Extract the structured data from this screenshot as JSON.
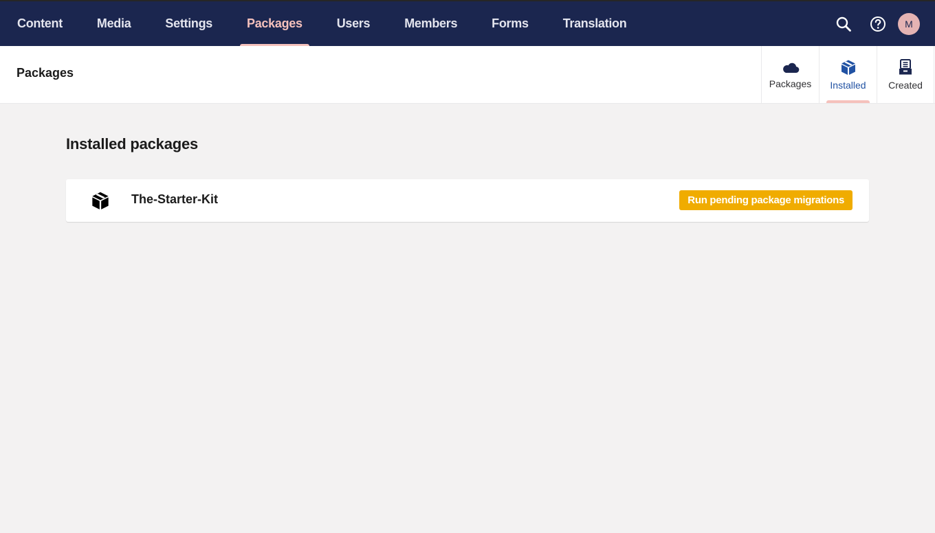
{
  "topnav": {
    "items": [
      {
        "label": "Content",
        "active": false
      },
      {
        "label": "Media",
        "active": false
      },
      {
        "label": "Settings",
        "active": false
      },
      {
        "label": "Packages",
        "active": true
      },
      {
        "label": "Users",
        "active": false
      },
      {
        "label": "Members",
        "active": false
      },
      {
        "label": "Forms",
        "active": false
      },
      {
        "label": "Translation",
        "active": false
      }
    ],
    "icons": [
      "search-icon",
      "help-icon"
    ],
    "avatar_initial": "M"
  },
  "header": {
    "title": "Packages",
    "apps": [
      {
        "label": "Packages",
        "icon": "cloud-icon",
        "active": false
      },
      {
        "label": "Installed",
        "icon": "box-icon",
        "active": true
      },
      {
        "label": "Created",
        "icon": "drawer-icon",
        "active": false
      }
    ]
  },
  "main": {
    "section_title": "Installed packages",
    "packages": [
      {
        "name": "The-Starter-Kit",
        "icon": "box-icon",
        "action_label": "Run pending package migrations"
      }
    ]
  },
  "colors": {
    "topbar": "#1b264f",
    "active_accent": "#f5c1bc",
    "warning_button": "#f0ac00",
    "active_app_text": "#2152a3"
  }
}
